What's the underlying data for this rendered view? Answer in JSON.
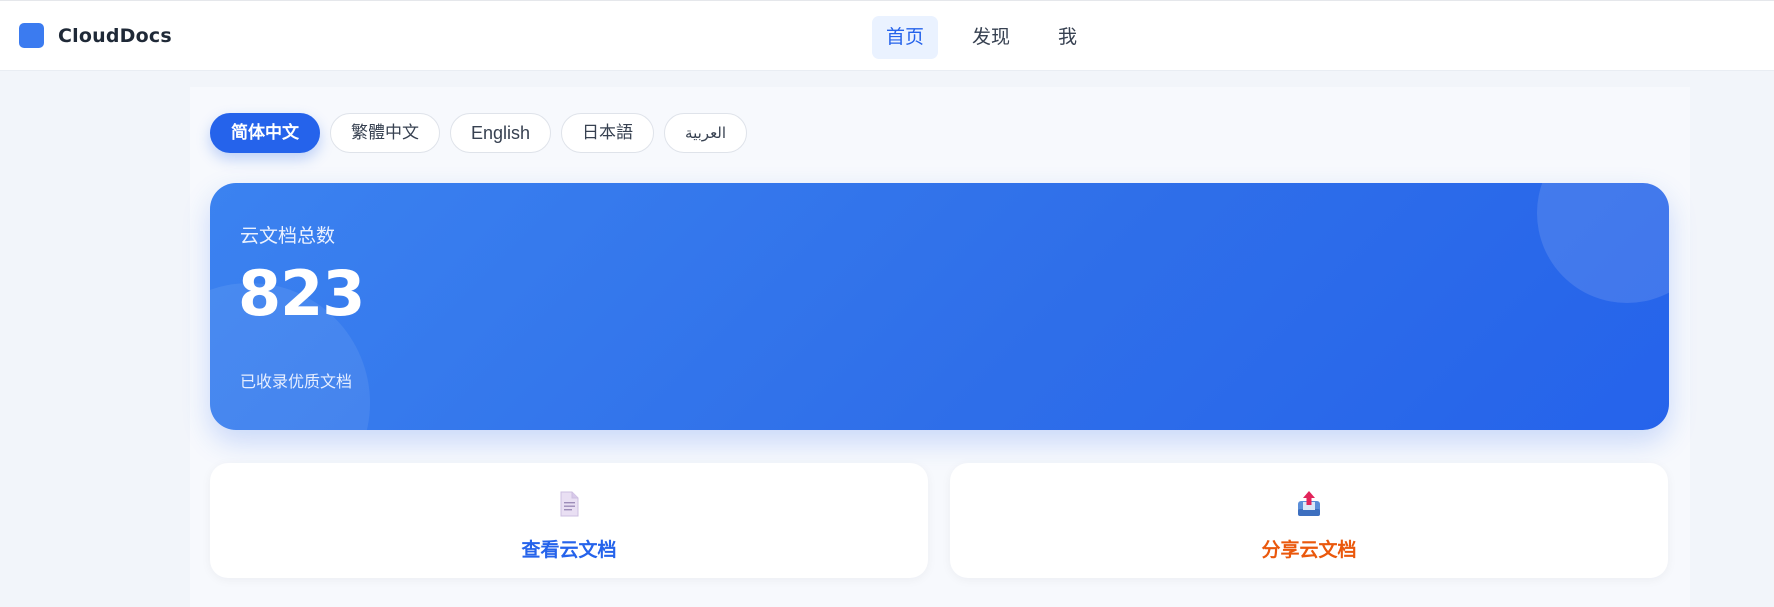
{
  "header": {
    "brand": "CloudDocs",
    "nav": [
      {
        "label": "首页",
        "active": true
      },
      {
        "label": "发现",
        "active": false
      },
      {
        "label": "我",
        "active": false
      }
    ]
  },
  "languages": [
    {
      "label": "简体中文",
      "active": true
    },
    {
      "label": "繁體中文",
      "active": false
    },
    {
      "label": "English",
      "active": false
    },
    {
      "label": "日本語",
      "active": false
    },
    {
      "label": "العربية",
      "active": false
    }
  ],
  "stat": {
    "label": "云文档总数",
    "value": "823",
    "subtitle": "已收录优质文档"
  },
  "actions": {
    "view": {
      "label": "查看云文档",
      "icon": "document-icon"
    },
    "share": {
      "label": "分享云文档",
      "icon": "share-upload-icon"
    }
  },
  "colors": {
    "accent": "#2563eb",
    "share_accent": "#ea580c",
    "background": "#f2f5fa"
  }
}
